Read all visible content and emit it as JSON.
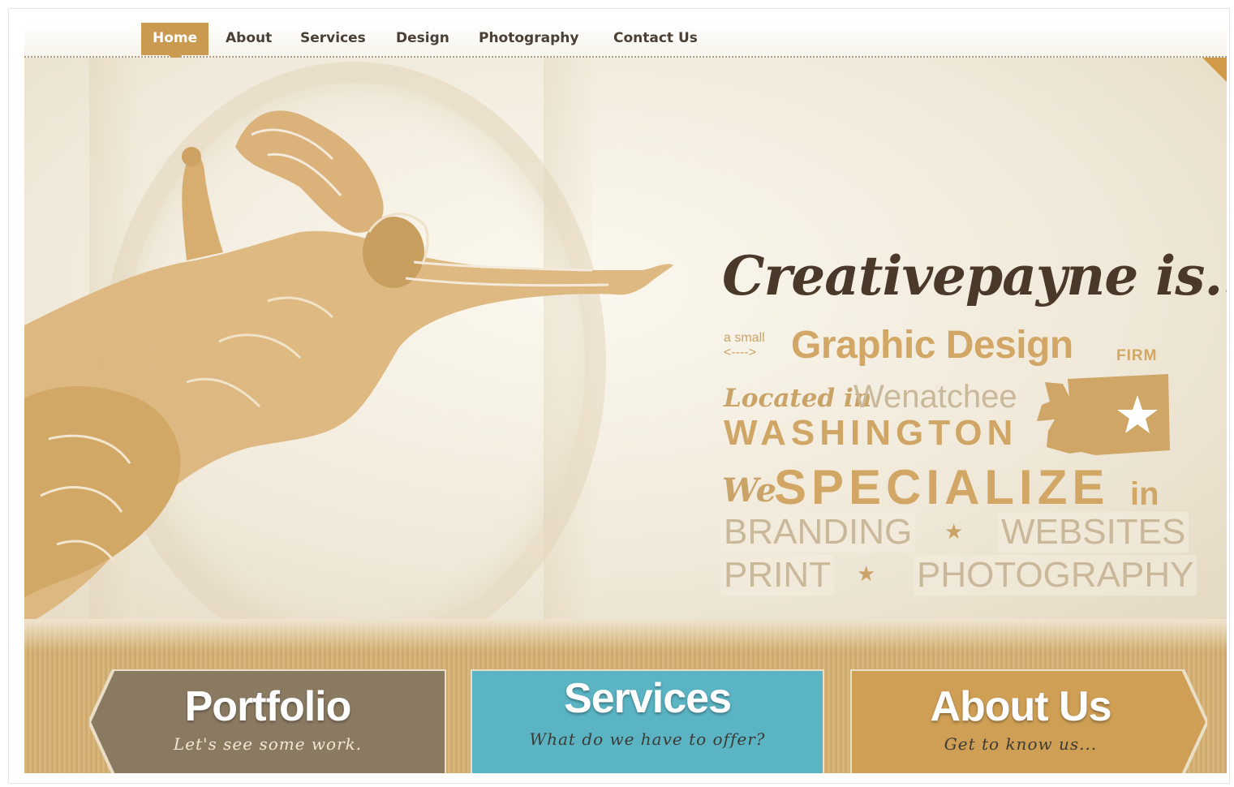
{
  "nav": {
    "items": [
      {
        "label": "Home",
        "active": true
      },
      {
        "label": "About",
        "active": false
      },
      {
        "label": "Services",
        "active": false
      },
      {
        "label": "Design",
        "active": false
      },
      {
        "label": "Photography",
        "active": false
      },
      {
        "label": "Contact Us",
        "active": false
      }
    ]
  },
  "hero": {
    "headline": "Creativepayne is...",
    "small_label_top": "a small",
    "small_label_arrow": "<---->",
    "graphic_design": "Graphic Design",
    "firm": "FIRM",
    "located_in": "Located in",
    "city": "Wenatchee",
    "state": "WASHINGTON",
    "we": "We",
    "specialize": "SPECIALIZE",
    "in": "in",
    "services": [
      "BRANDING",
      "WEBSITES",
      "PRINT",
      "PHOTOGRAPHY"
    ],
    "star_glyph": "★"
  },
  "cta": [
    {
      "title": "Portfolio",
      "subtitle": "Let's see some work.",
      "color": "#8b7a62"
    },
    {
      "title": "Services",
      "subtitle": "What do we have to offer?",
      "color": "#5ab4c4"
    },
    {
      "title": "About Us",
      "subtitle": "Get to know us...",
      "color": "#cf9f55"
    }
  ],
  "colors": {
    "accent": "#c99a4f",
    "headline": "#4a392b",
    "gold": "#d2a664",
    "muted": "#c9b89a"
  },
  "icons": [
    "star-icon",
    "washington-state-icon",
    "nav-pointer-icon"
  ]
}
